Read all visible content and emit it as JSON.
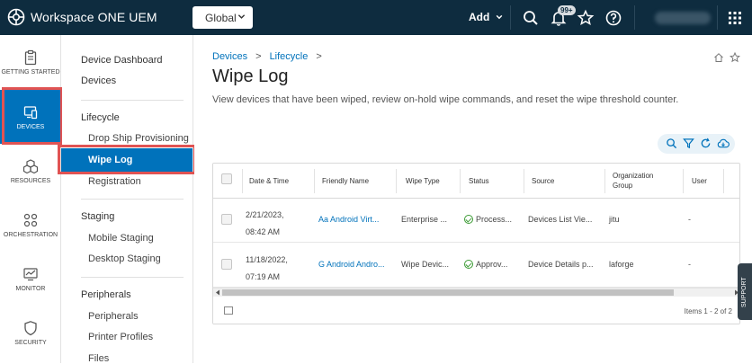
{
  "topbar": {
    "app_title": "Workspace ONE UEM",
    "org_selector": "Global",
    "add_label": "Add",
    "notification_badge": "99+"
  },
  "leftnav": {
    "items": [
      {
        "label": "GETTING STARTED",
        "icon": "clipboard-icon"
      },
      {
        "label": "DEVICES",
        "icon": "devices-icon",
        "active": true
      },
      {
        "label": "RESOURCES",
        "icon": "resources-icon"
      },
      {
        "label": "ORCHESTRATION",
        "icon": "orchestration-icon"
      },
      {
        "label": "MONITOR",
        "icon": "monitor-icon"
      },
      {
        "label": "SECURITY",
        "icon": "shield-icon"
      }
    ]
  },
  "subnav": {
    "dashboard": "Device Dashboard",
    "devices": "Devices",
    "lifecycle_heading": "Lifecycle",
    "drop_ship": "Drop Ship Provisioning",
    "wipe_log": "Wipe Log",
    "registration": "Registration",
    "staging_heading": "Staging",
    "mobile_staging": "Mobile Staging",
    "desktop_staging": "Desktop Staging",
    "peripherals_heading": "Peripherals",
    "peripherals": "Peripherals",
    "printer_profiles": "Printer Profiles",
    "files": "Files"
  },
  "breadcrumb": {
    "first": "Devices",
    "second": "Lifecycle"
  },
  "page": {
    "title": "Wipe Log",
    "description": "View devices that have been wiped, review on-hold wipe commands, and reset the wipe threshold counter."
  },
  "table": {
    "columns": {
      "date": "Date & Time",
      "friendly_name": "Friendly Name",
      "wipe_type": "Wipe Type",
      "status": "Status",
      "source": "Source",
      "org_group_1": "Organization",
      "org_group_2": "Group",
      "user": "User"
    },
    "rows": [
      {
        "date": "2/21/2023,",
        "time": "08:42 AM",
        "friendly_name": "Aa Android Virt...",
        "wipe_type": "Enterprise ...",
        "status": "Process...",
        "source": "Devices List Vie...",
        "org_group": "jitu",
        "user": "-"
      },
      {
        "date": "11/18/2022,",
        "time": "07:19 AM",
        "friendly_name": "G Android Andro...",
        "wipe_type": "Wipe Devic...",
        "status": "Approv...",
        "source": "Device Details p...",
        "org_group": "laforge",
        "user": "-"
      }
    ],
    "items_count": "Items 1 - 2 of 2"
  },
  "support_tab": "SUPPORT",
  "colors": {
    "topbar": "#0e2c3f",
    "accent": "#0072bb",
    "highlight_outline": "#e05353",
    "status_ok": "#3c9b35"
  }
}
